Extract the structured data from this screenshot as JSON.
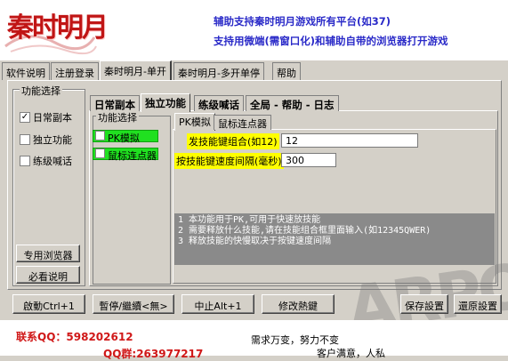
{
  "header": {
    "logo_text": "秦时明月",
    "banner_line1": "辅助支持秦时明月游戏所有平台(如37)",
    "banner_line2": "支持用微端(需窗口化)和辅助自带的浏览器打开游戏"
  },
  "main_tabs": [
    {
      "label": "软件说明"
    },
    {
      "label": "注册登录"
    },
    {
      "label": "秦时明月-单开"
    },
    {
      "label": "秦时明月-多开单停"
    },
    {
      "label": "帮助"
    }
  ],
  "left_group": {
    "title": "功能选择",
    "options": [
      {
        "label": "日常副本",
        "checked": true
      },
      {
        "label": "独立功能",
        "checked": false
      },
      {
        "label": "练级喊话",
        "checked": false
      }
    ],
    "browser_button": "专用浏览器",
    "readme_button": "必看说明"
  },
  "inner_tabs": [
    {
      "label": "日常副本"
    },
    {
      "label": "独立功能"
    },
    {
      "label": "练级喊话"
    },
    {
      "label": "全局 - 帮助 - 日志"
    }
  ],
  "sub_group": {
    "title": "功能选择",
    "items": [
      {
        "label": "PK模拟"
      },
      {
        "label": "鼠标连点器"
      }
    ]
  },
  "sub_tabs": [
    {
      "label": "PK模拟"
    },
    {
      "label": "鼠标连点器"
    }
  ],
  "pk_form": {
    "combo_label": "发技能键组合(如12)",
    "combo_value": "12",
    "interval_label": "按技能键速度间隔(毫秒)",
    "interval_value": "300"
  },
  "info_lines": [
    "1 本功能用于PK,可用于快速放技能",
    "2 需要释放什么技能,请在技能组合框里面输入(如12345QWER)",
    "3 释放技能的快慢取决于按键速度间隔"
  ],
  "bottom_buttons": {
    "start": "啟動Ctrl+1",
    "pause": "暫停/繼續<無>",
    "stop": "中止Alt+1",
    "hotkey": "修改熱鍵",
    "save": "保存設置",
    "restore": "還原設置"
  },
  "footer": {
    "qq1": "联系QQ：598202612",
    "qq2": "QQ群:263977217",
    "slogan1": "需求万变，努力不变",
    "slogan2": "客户满意，人私"
  },
  "watermark": "ARPON",
  "colors": {
    "banner_blue": "#2a2ac8",
    "footer_red": "#d01818",
    "highlight_yellow": "#ffff00",
    "item_green": "#20e020"
  }
}
